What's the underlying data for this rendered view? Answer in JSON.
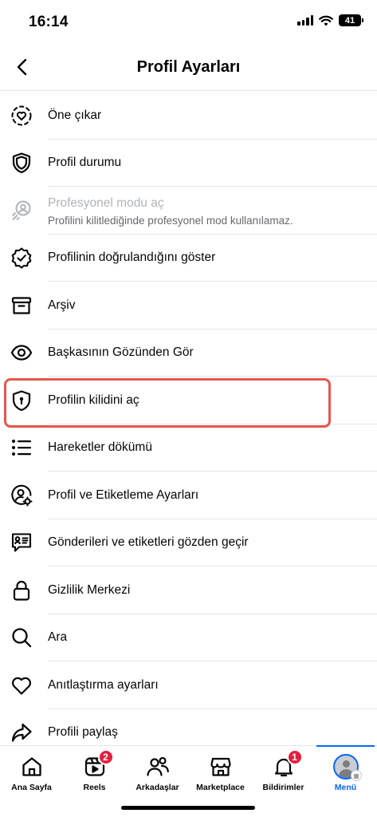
{
  "status_bar": {
    "time": "16:14",
    "battery": "41"
  },
  "header": {
    "title": "Profil Ayarları"
  },
  "menu": {
    "items": [
      {
        "label": "Öne çıkar"
      },
      {
        "label": "Profil durumu"
      },
      {
        "label": "Profesyonel modu aç",
        "sublabel": "Profilini kilitlediğinde profesyonel mod kullanılamaz."
      },
      {
        "label": "Profilinin doğrulandığını göster"
      },
      {
        "label": "Arşiv"
      },
      {
        "label": "Başkasının Gözünden Gör"
      },
      {
        "label": "Profilin kilidini aç"
      },
      {
        "label": "Hareketler dökümü"
      },
      {
        "label": "Profil ve Etiketleme Ayarları"
      },
      {
        "label": "Gönderileri ve etiketleri gözden geçir"
      },
      {
        "label": "Gizlilik Merkezi"
      },
      {
        "label": "Ara"
      },
      {
        "label": "Anıtlaştırma ayarları"
      },
      {
        "label": "Profili paylaş"
      }
    ]
  },
  "bottom_nav": {
    "items": [
      {
        "label": "Ana Sayfa"
      },
      {
        "label": "Reels",
        "badge": "2"
      },
      {
        "label": "Arkadaşlar"
      },
      {
        "label": "Marketplace"
      },
      {
        "label": "Bildirimler",
        "badge": "1"
      },
      {
        "label": "Menü"
      }
    ]
  },
  "colors": {
    "accent": "#0866ff",
    "highlight": "#e4574d",
    "badge": "#e41e3f"
  }
}
